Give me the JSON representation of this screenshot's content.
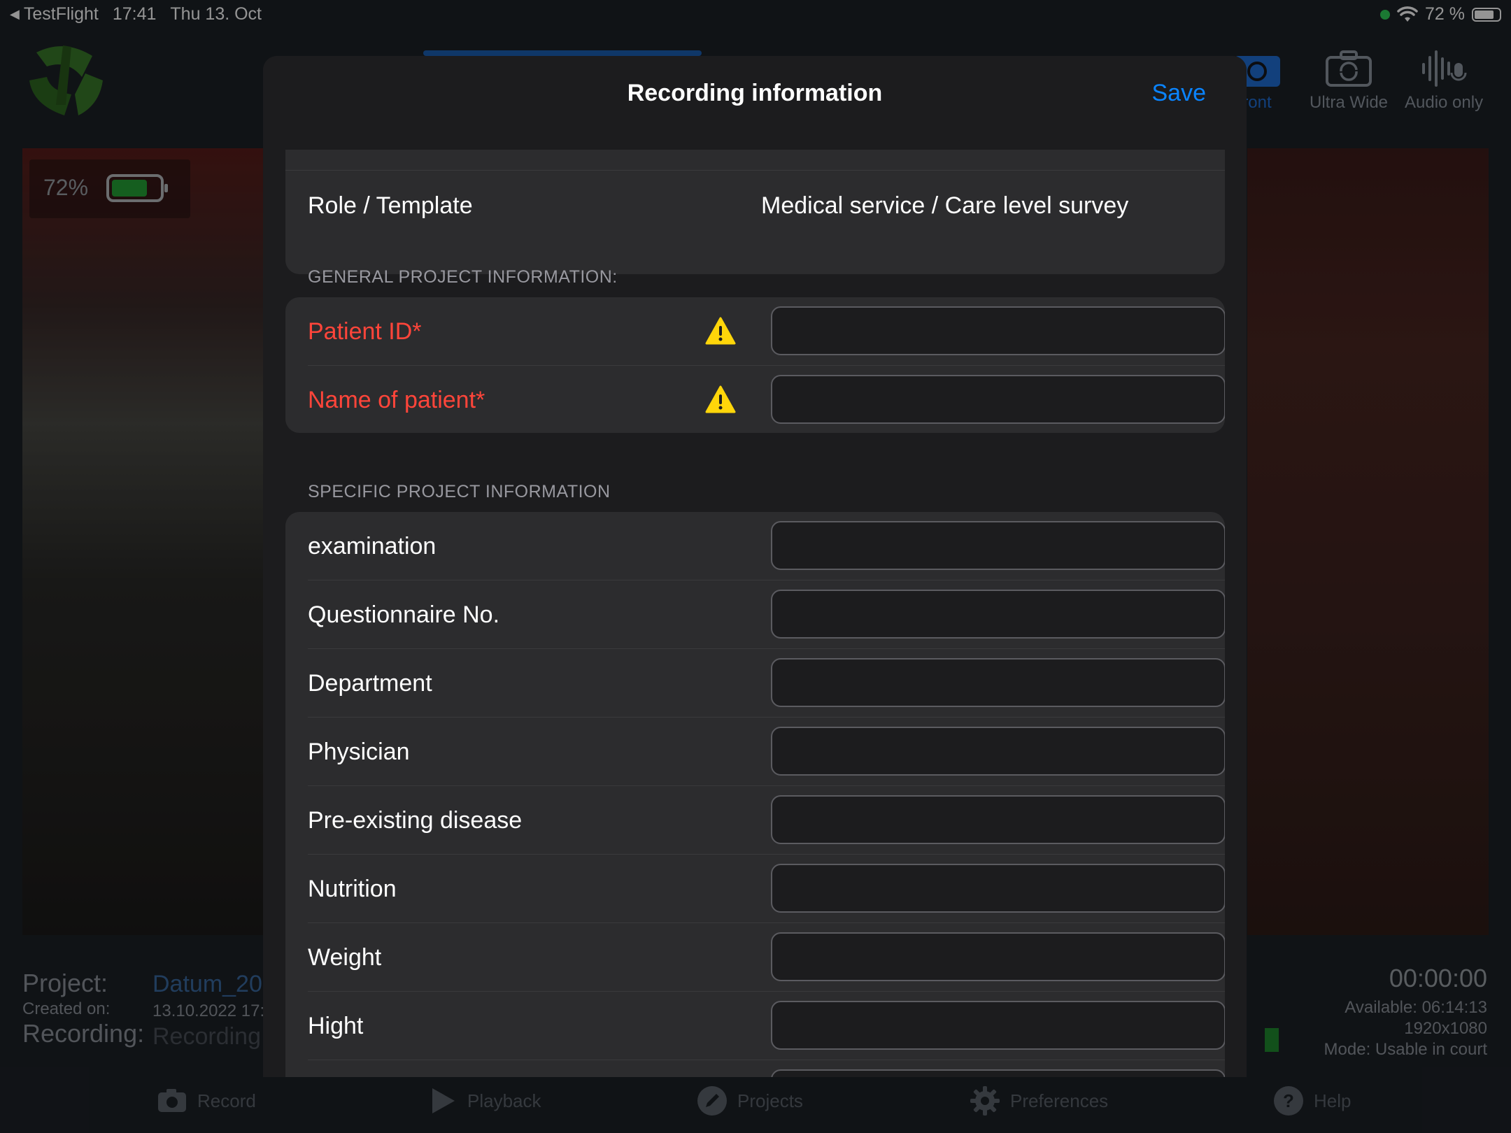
{
  "status_bar": {
    "back_app": "TestFlight",
    "time": "17:41",
    "date": "Thu 13. Oct",
    "battery_percent": "72 %"
  },
  "camera_modes": {
    "front_partial": "ront",
    "ultra_wide": "Ultra Wide",
    "audio_only": "Audio only"
  },
  "preview": {
    "battery_percent": "72%",
    "battery_level": 0.72
  },
  "project_panel": {
    "project_label": "Project:",
    "project_value": "Datum_20",
    "created_label": "Created on:",
    "created_value": "13.10.2022 17:",
    "recording_label": "Recording:",
    "recording_value": "Recording"
  },
  "recording_stats": {
    "timer": "00:00:00",
    "available": "Available: 06:14:13",
    "resolution": "1920x1080",
    "mode": "Mode: Usable in court"
  },
  "bottom_nav": [
    {
      "label": "Record",
      "icon": "camera-icon"
    },
    {
      "label": "Playback",
      "icon": "play-icon"
    },
    {
      "label": "Projects",
      "icon": "pencil-icon"
    },
    {
      "label": "Preferences",
      "icon": "gear-icon"
    },
    {
      "label": "Help",
      "icon": "help-icon"
    }
  ],
  "modal": {
    "title": "Recording information",
    "save_label": "Save",
    "role_row": {
      "label": "Role / Template",
      "value": "Medical service / Care level survey"
    },
    "general_header": "GENERAL PROJECT INFORMATION:",
    "general_fields": [
      {
        "label": "Patient ID*",
        "value": "",
        "required": true
      },
      {
        "label": "Name of patient*",
        "value": "",
        "required": true
      }
    ],
    "specific_header": "SPECIFIC PROJECT INFORMATION",
    "specific_fields": [
      {
        "label": "examination",
        "value": ""
      },
      {
        "label": "Questionnaire No.",
        "value": ""
      },
      {
        "label": "Department",
        "value": ""
      },
      {
        "label": "Physician",
        "value": ""
      },
      {
        "label": "Pre-existing disease",
        "value": ""
      },
      {
        "label": "Nutrition",
        "value": ""
      },
      {
        "label": "Weight",
        "value": ""
      },
      {
        "label": "Hight",
        "value": ""
      }
    ]
  },
  "colors": {
    "accent": "#0a84ff",
    "required": "#ff453a",
    "warning": "#ffd60a",
    "battery_fill": "#25a336"
  }
}
